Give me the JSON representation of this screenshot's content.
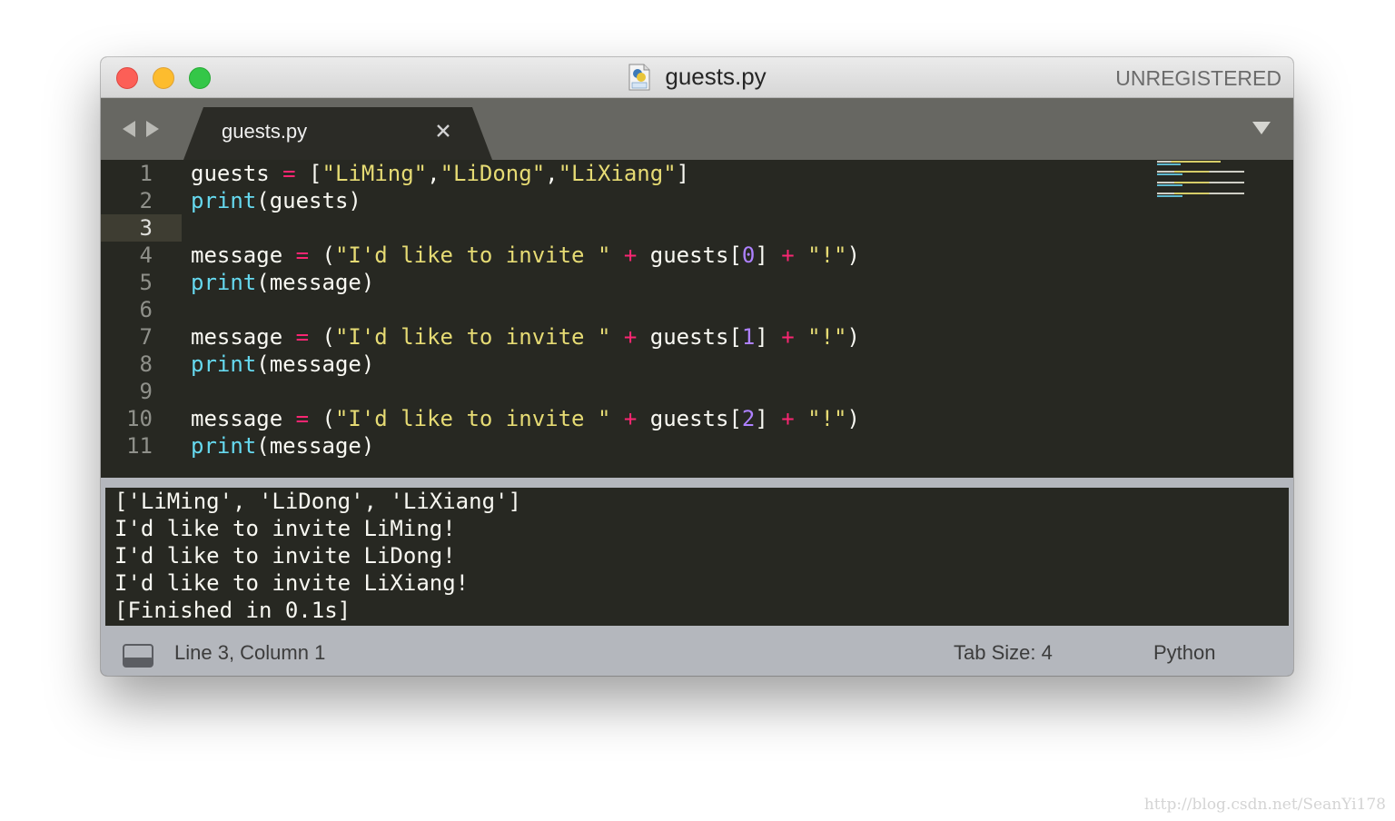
{
  "window": {
    "title": "guests.py",
    "registration": "UNREGISTERED"
  },
  "tabs": [
    {
      "label": "guests.py",
      "active": true
    }
  ],
  "editor": {
    "current_line": 3,
    "line_numbers": [
      "1",
      "2",
      "3",
      "4",
      "5",
      "6",
      "7",
      "8",
      "9",
      "10",
      "11"
    ],
    "lines": [
      [
        {
          "t": "guests",
          "k": "id"
        },
        {
          "t": " ",
          "k": "id"
        },
        {
          "t": "=",
          "k": "op"
        },
        {
          "t": " [",
          "k": "id"
        },
        {
          "t": "\"LiMing\"",
          "k": "str"
        },
        {
          "t": ",",
          "k": "id"
        },
        {
          "t": "\"LiDong\"",
          "k": "str"
        },
        {
          "t": ",",
          "k": "id"
        },
        {
          "t": "\"LiXiang\"",
          "k": "str"
        },
        {
          "t": "]",
          "k": "id"
        }
      ],
      [
        {
          "t": "print",
          "k": "fn"
        },
        {
          "t": "(guests)",
          "k": "id"
        }
      ],
      [],
      [
        {
          "t": "message ",
          "k": "id"
        },
        {
          "t": "=",
          "k": "op"
        },
        {
          "t": " (",
          "k": "id"
        },
        {
          "t": "\"I'd like to invite \"",
          "k": "str"
        },
        {
          "t": " ",
          "k": "id"
        },
        {
          "t": "+",
          "k": "op"
        },
        {
          "t": " guests[",
          "k": "id"
        },
        {
          "t": "0",
          "k": "num"
        },
        {
          "t": "] ",
          "k": "id"
        },
        {
          "t": "+",
          "k": "op"
        },
        {
          "t": " ",
          "k": "id"
        },
        {
          "t": "\"!\"",
          "k": "str"
        },
        {
          "t": ")",
          "k": "id"
        }
      ],
      [
        {
          "t": "print",
          "k": "fn"
        },
        {
          "t": "(message)",
          "k": "id"
        }
      ],
      [],
      [
        {
          "t": "message ",
          "k": "id"
        },
        {
          "t": "=",
          "k": "op"
        },
        {
          "t": " (",
          "k": "id"
        },
        {
          "t": "\"I'd like to invite \"",
          "k": "str"
        },
        {
          "t": " ",
          "k": "id"
        },
        {
          "t": "+",
          "k": "op"
        },
        {
          "t": " guests[",
          "k": "id"
        },
        {
          "t": "1",
          "k": "num"
        },
        {
          "t": "] ",
          "k": "id"
        },
        {
          "t": "+",
          "k": "op"
        },
        {
          "t": " ",
          "k": "id"
        },
        {
          "t": "\"!\"",
          "k": "str"
        },
        {
          "t": ")",
          "k": "id"
        }
      ],
      [
        {
          "t": "print",
          "k": "fn"
        },
        {
          "t": "(message)",
          "k": "id"
        }
      ],
      [],
      [
        {
          "t": "message ",
          "k": "id"
        },
        {
          "t": "=",
          "k": "op"
        },
        {
          "t": " (",
          "k": "id"
        },
        {
          "t": "\"I'd like to invite \"",
          "k": "str"
        },
        {
          "t": " ",
          "k": "id"
        },
        {
          "t": "+",
          "k": "op"
        },
        {
          "t": " guests[",
          "k": "id"
        },
        {
          "t": "2",
          "k": "num"
        },
        {
          "t": "] ",
          "k": "id"
        },
        {
          "t": "+",
          "k": "op"
        },
        {
          "t": " ",
          "k": "id"
        },
        {
          "t": "\"!\"",
          "k": "str"
        },
        {
          "t": ")",
          "k": "id"
        }
      ],
      [
        {
          "t": "print",
          "k": "fn"
        },
        {
          "t": "(message)",
          "k": "id"
        }
      ]
    ]
  },
  "output": {
    "lines": [
      "['LiMing', 'LiDong', 'LiXiang']",
      "I'd like to invite LiMing!",
      "I'd like to invite LiDong!",
      "I'd like to invite LiXiang!",
      "[Finished in 0.1s]"
    ]
  },
  "statusbar": {
    "position": "Line 3, Column 1",
    "tab_size": "Tab Size: 4",
    "syntax": "Python"
  },
  "watermark": "http://blog.csdn.net/SeanYi178",
  "icons": {
    "close": "close-icon",
    "nav_back": "arrow-left-icon",
    "nav_forward": "arrow-right-icon",
    "tab_menu": "triangle-down-icon",
    "panel_toggle": "panel-icon",
    "file": "python-file-icon"
  },
  "colors": {
    "editor_bg": "#272822",
    "keyword_op": "#f92672",
    "string": "#e6db74",
    "function": "#66d9ef",
    "number": "#ae81ff",
    "text": "#f8f8f2"
  }
}
